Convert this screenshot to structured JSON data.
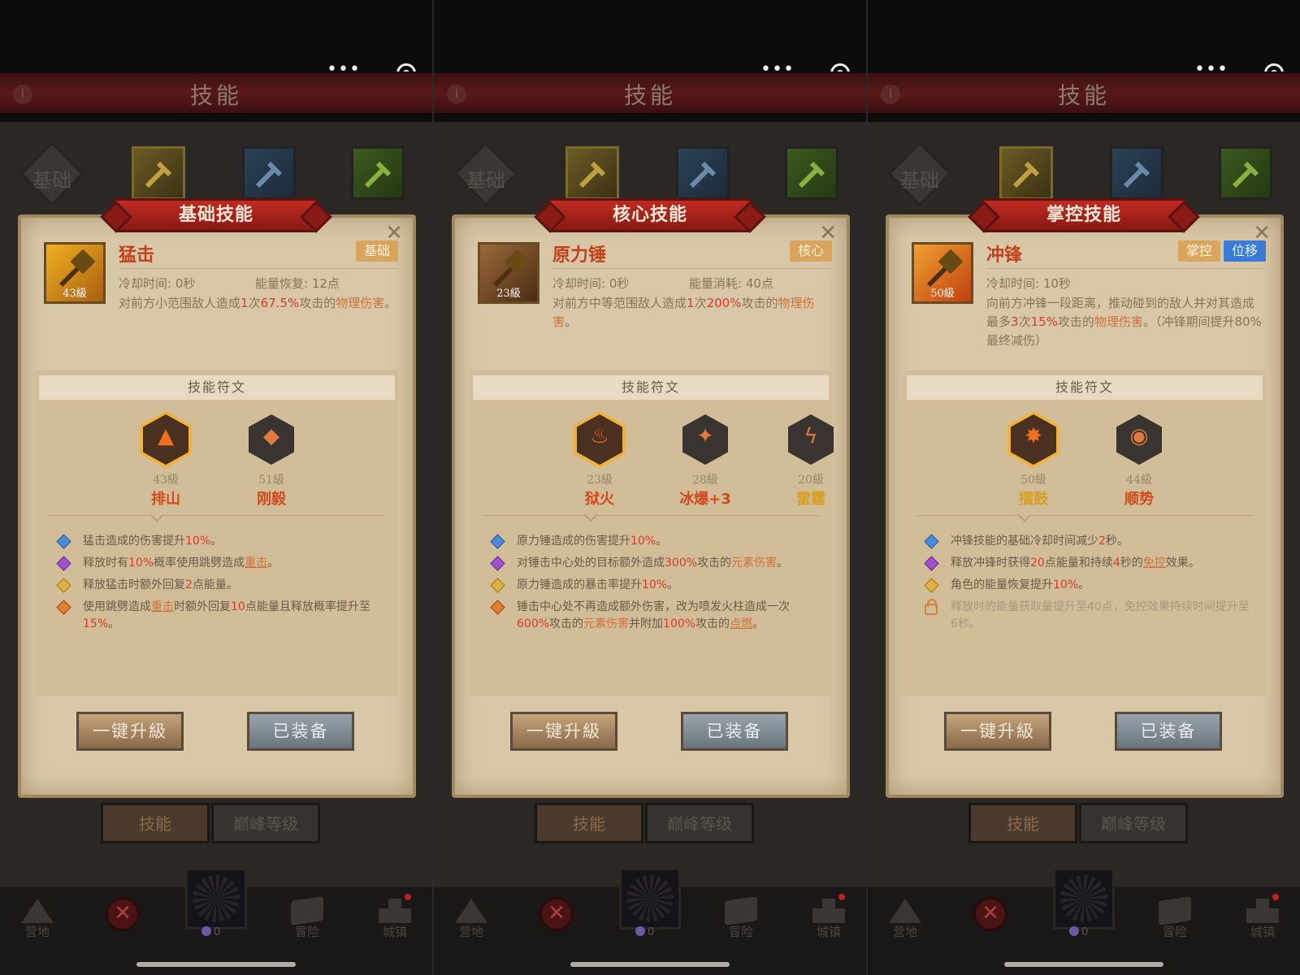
{
  "header_title": "技能",
  "panels": [
    {
      "tab_label": "基础",
      "ribbon": "基础技能",
      "skill": {
        "name": "猛击",
        "level": "43級",
        "tags": [
          {
            "label": "基础",
            "style": "o"
          }
        ]
      },
      "meta": {
        "cooldown": "冷却时间: 0秒",
        "energy": "能量恢复: 12点"
      },
      "desc_html": "对前方小范围敌人造成<span class='red'>1</span>次<span class='red'>67.5%</span>攻击的<span class='org'>物理伤害</span>。",
      "rune_title": "技能符文",
      "runes": [
        {
          "level": "43級",
          "name": "排山",
          "active": true,
          "symbol": "▲",
          "color": "#d24a1a"
        },
        {
          "level": "51級",
          "name": "刚毅",
          "active": false,
          "symbol": "◆",
          "color": "#d24a1a"
        }
      ],
      "effects": [
        {
          "type": "e1",
          "html": "猛击造成的伤害提升<span class='red'>10%</span>。"
        },
        {
          "type": "e2",
          "html": "释放时有<span class='red'>10%</span>概率使用跳劈造成<span class='org und'>重击</span>。"
        },
        {
          "type": "e3",
          "html": "释放猛击时额外回复<span class='red'>2</span>点能量。"
        },
        {
          "type": "e4",
          "html": "使用跳劈造成<span class='org und'>重击</span>时额外回复<span class='red'>10</span>点能量且释放概率提升至<span class='red'>15%</span>。"
        }
      ],
      "btn_upgrade": "一键升級",
      "btn_equipped": "已装备"
    },
    {
      "tab_label": "基础",
      "ribbon": "核心技能",
      "skill": {
        "name": "原力锤",
        "level": "23級",
        "tags": [
          {
            "label": "核心",
            "style": "o"
          }
        ]
      },
      "meta": {
        "cooldown": "冷却时间: 0秒",
        "energy": "能量消耗: 40点"
      },
      "desc_html": "对前方中等范围敌人造成<span class='red'>1</span>次<span class='red'>200%</span>攻击的<span class='org'>物理伤害</span>。",
      "rune_title": "技能符文",
      "runes": [
        {
          "level": "23級",
          "name": "狱火",
          "active": true,
          "symbol": "♨",
          "color": "#d24a1a"
        },
        {
          "level": "28級",
          "name": "冰爆+3",
          "active": false,
          "symbol": "✦",
          "color": "#d24a1a"
        },
        {
          "level": "20級",
          "name": "雷霆",
          "active": false,
          "symbol": "ϟ",
          "color": "#d8a020"
        }
      ],
      "effects": [
        {
          "type": "e1",
          "html": "原力锤造成的伤害提升<span class='red'>10%</span>。"
        },
        {
          "type": "e2",
          "html": "对锤击中心处的目标额外造成<span class='red'>300%</span>攻击的<span class='org'>元素伤害</span>。"
        },
        {
          "type": "e3",
          "html": "原力锤造成的暴击率提升<span class='red'>10%</span>。"
        },
        {
          "type": "e4",
          "html": "锤击中心处不再造成额外伤害，改为喷发火柱造成一次<span class='red'>600%</span>攻击的<span class='org'>元素伤害</span>并附加<span class='red'>100%</span>攻击的<span class='org und'>点燃</span>。"
        }
      ],
      "btn_upgrade": "一键升級",
      "btn_equipped": "已装备"
    },
    {
      "tab_label": "基础",
      "ribbon": "掌控技能",
      "skill": {
        "name": "冲锋",
        "level": "50級",
        "tags": [
          {
            "label": "掌控",
            "style": "o"
          },
          {
            "label": "位移",
            "style": "bl"
          }
        ]
      },
      "meta": {
        "cooldown": "冷却时间: 10秒",
        "energy": ""
      },
      "desc_html": "向前方冲锋一段距离，推动碰到的敌人并对其造成最多<span class='red'>3</span>次<span class='red'>15%</span>攻击的<span class='org'>物理伤害</span>。（冲锋期间提升80%最终减伤）",
      "rune_title": "技能符文",
      "runes": [
        {
          "level": "50級",
          "name": "擂鼓",
          "active": true,
          "symbol": "✸",
          "color": "#d8a020"
        },
        {
          "level": "44級",
          "name": "顺势",
          "active": false,
          "symbol": "◉",
          "color": "#d24a1a"
        }
      ],
      "effects": [
        {
          "type": "e1",
          "html": "冲锋技能的基础冷却时间减少<span class='red'>2</span>秒。"
        },
        {
          "type": "e2",
          "html": "释放冲锋时获得<span class='red'>20</span>点能量和持续<span class='red'>4</span>秒的<span class='org und'>免控</span>效果。"
        },
        {
          "type": "e3",
          "html": "角色的能量恢复提升<span class='red'>10%</span>。"
        },
        {
          "type": "lock",
          "html": "释放时的能量获取量提升至40点，免控效果持续时间提升至6秒。"
        }
      ],
      "btn_upgrade": "一键升級",
      "btn_equipped": "已装备"
    }
  ],
  "bottom_tabs": {
    "skills": "技能",
    "peak": "巅峰等级"
  },
  "nav": {
    "camp": "营地",
    "adventure": "冒险",
    "town": "城镇",
    "count": "0"
  },
  "colors": {
    "accent_red": "#c02a20",
    "parchment": "#d9c8a7",
    "text_orange": "#d2703a"
  }
}
